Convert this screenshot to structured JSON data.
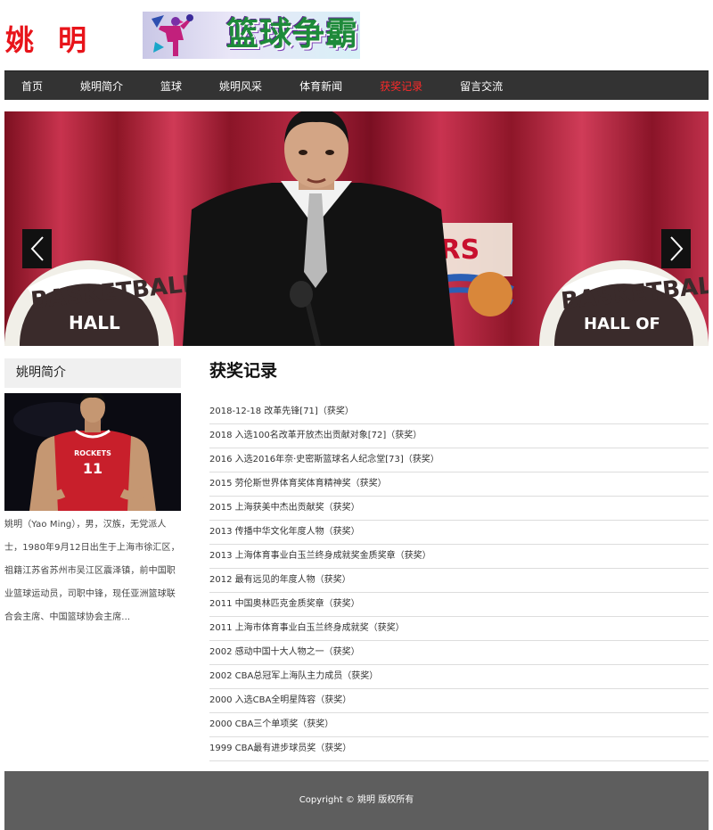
{
  "site": {
    "title": "姚 明"
  },
  "banner": {
    "text": "篮球争霸"
  },
  "nav": {
    "items": [
      {
        "label": "首页"
      },
      {
        "label": "姚明简介"
      },
      {
        "label": "篮球"
      },
      {
        "label": "姚明风采"
      },
      {
        "label": "体育新闻"
      },
      {
        "label": "获奖记录",
        "active": true
      },
      {
        "label": "留言交流"
      }
    ]
  },
  "slider": {
    "logo_left": "BASKETBALL",
    "logo_left_sub": "HALL",
    "logo_mid": "ERS",
    "logo_right": "BASKETBALL",
    "logo_right_sub": "HALL OF"
  },
  "sidebar": {
    "title": "姚明简介",
    "jersey_team": "ROCKETS",
    "jersey_number": "11",
    "intro": "姚明（Yao Ming），男，汉族，无党派人士，1980年9月12日出生于上海市徐汇区，祖籍江苏省苏州市吴江区震泽镇，前中国职业篮球运动员，司职中锋，现任亚洲篮球联合会主席、中国篮球协会主席..."
  },
  "main": {
    "title": "获奖记录",
    "awards": [
      "2018-12-18 改革先锋[71]（获奖）",
      "2018 入选100名改革开放杰出贡献对象[72]（获奖）",
      "2016 入选2016年奈·史密斯篮球名人纪念堂[73]（获奖）",
      "2015 劳伦斯世界体育奖体育精神奖（获奖）",
      "2015 上海获美中杰出贡献奖（获奖）",
      "2013 传播中华文化年度人物（获奖）",
      "2013 上海体育事业白玉兰终身成就奖金质奖章（获奖）",
      "2012 最有远见的年度人物（获奖）",
      "2011 中国奥林匹克金质奖章（获奖）",
      "2011 上海市体育事业白玉兰终身成就奖（获奖）",
      "2002 感动中国十大人物之一（获奖）",
      "2002 CBA总冠军上海队主力成员（获奖）",
      "2000 入选CBA全明星阵容（获奖）",
      "2000 CBA三个单项奖（获奖）",
      "1999 CBA最有进步球员奖（获奖）"
    ]
  },
  "footer": {
    "copyright": "Copyright © 姚明 版权所有"
  },
  "colors": {
    "accent": "#e8141a",
    "nav_bg": "#333333",
    "footer_bg": "#5e5e5e"
  }
}
